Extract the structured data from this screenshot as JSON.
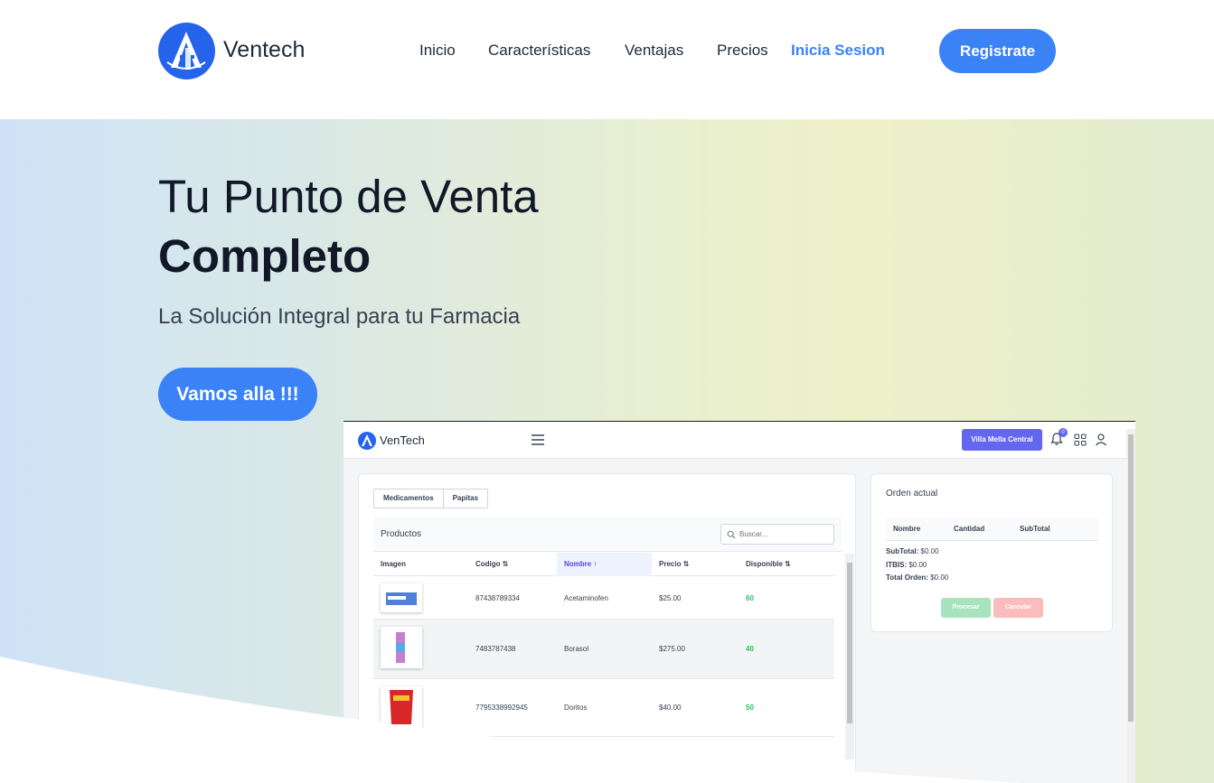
{
  "header": {
    "brand": "Ventech",
    "nav": [
      "Inicio",
      "Características",
      "Ventajas",
      "Precios"
    ],
    "login": "Inicia Sesion",
    "register": "Registrate"
  },
  "hero": {
    "title": "Tu Punto de Venta",
    "title_bold": "Completo",
    "subtitle": "La Solución Integral para tu Farmacia",
    "cta": "Vamos alla !!!"
  },
  "app": {
    "brand": "VenTech",
    "branch": "Villa Mella Central",
    "notifications": "0",
    "tabs": [
      "Medicamentos",
      "Papitas"
    ],
    "products_title": "Productos",
    "search_placeholder": "Buscar...",
    "columns": [
      "Imagen",
      "Codigo",
      "Nombre",
      "Precio",
      "Disponible"
    ],
    "rows": [
      {
        "code": "87438789334",
        "name": "Acetaminofen",
        "price": "$25.00",
        "available": "60"
      },
      {
        "code": "7483787438",
        "name": "Borasol",
        "price": "$275.00",
        "available": "40"
      },
      {
        "code": "7795338992945",
        "name": "Doritos",
        "price": "$40.00",
        "available": "50"
      }
    ],
    "order": {
      "title": "Orden actual",
      "columns": [
        "Nombre",
        "Cantidad",
        "SubTotal"
      ],
      "subtotal_label": "SubTotal:",
      "subtotal": "$0.00",
      "itbis_label": "ITBIS:",
      "itbis": "$0.00",
      "total_label": "Total Orden:",
      "total": "$0.00",
      "process": "Procesar",
      "cancel": "Cancelar"
    }
  },
  "colors": {
    "primary": "#3b82f6",
    "indigo": "#6366f1",
    "success": "#22c55e"
  }
}
